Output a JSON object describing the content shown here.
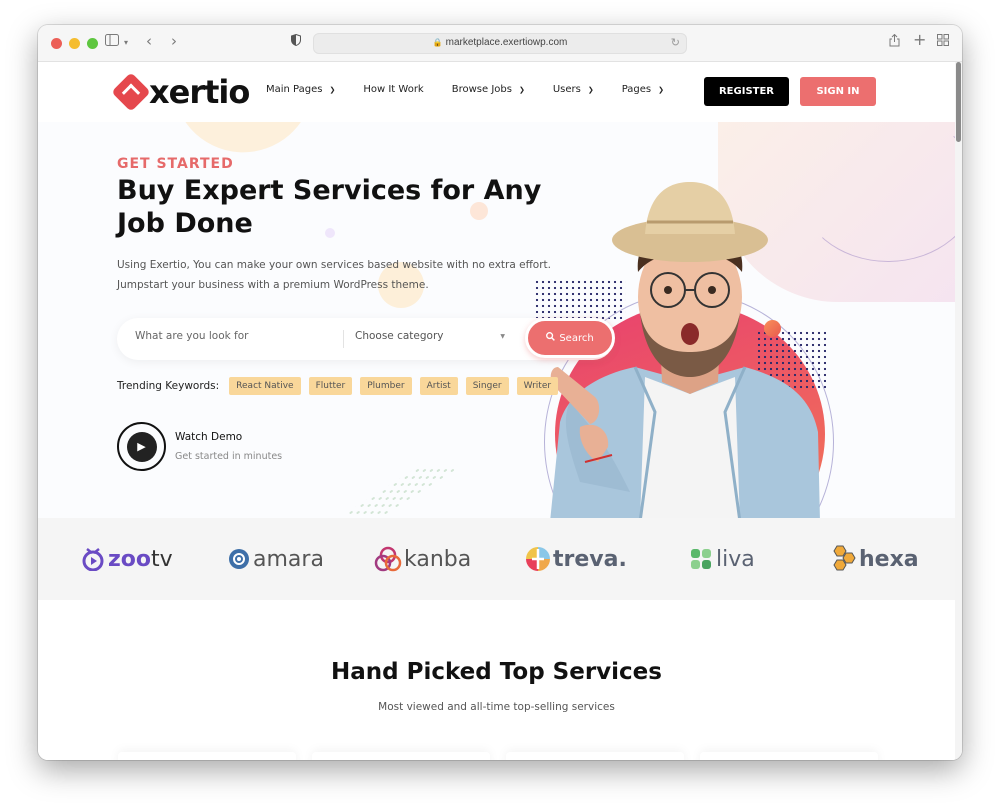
{
  "browser": {
    "url": "marketplace.exertiowp.com",
    "traffic_lights": [
      "#ec5f57",
      "#f5bd2f",
      "#5ec63f"
    ]
  },
  "header": {
    "logo_text": "xertio",
    "nav": [
      {
        "label": "Main Pages",
        "has_dropdown": true
      },
      {
        "label": "How It Work",
        "has_dropdown": false
      },
      {
        "label": "Browse Jobs",
        "has_dropdown": true
      },
      {
        "label": "Users",
        "has_dropdown": true
      },
      {
        "label": "Pages",
        "has_dropdown": true
      }
    ],
    "register_label": "REGISTER",
    "signin_label": "SIGN IN"
  },
  "hero": {
    "eyebrow": "GET STARTED",
    "headline": "Buy Expert Services for Any Job Done",
    "lead_line1": "Using Exertio, You can make your own services based website with no extra effort.",
    "lead_line2": "Jumpstart your business with a premium WordPress theme.",
    "search": {
      "placeholder": "What are you look for",
      "value": "",
      "category_selected": "Choose category",
      "button_label": "Search"
    },
    "trending_label": "Trending Keywords:",
    "trending_tags": [
      "React Native",
      "Flutter",
      "Plumber",
      "Artist",
      "Singer",
      "Writer"
    ],
    "demo_title": "Watch Demo",
    "demo_subtitle": "Get started in minutes"
  },
  "brands": [
    {
      "name": "zootv",
      "part1": "zoo",
      "part2": "tv",
      "color": "#6a4bc4"
    },
    {
      "name": "amara",
      "part1": "amara",
      "color": "#3e6fa8"
    },
    {
      "name": "kanba",
      "part1": "kanba",
      "color": "#c2366f"
    },
    {
      "name": "treva",
      "part1": "treva.",
      "color": "#e9893b"
    },
    {
      "name": "liva",
      "part1": "liva",
      "color": "#4cae5f"
    },
    {
      "name": "hexa",
      "part1": "hexa",
      "color": "#f0a93a"
    }
  ],
  "services": {
    "title": "Hand Picked Top Services",
    "subtitle": "Most viewed and all-time top-selling services"
  },
  "colors": {
    "accent": "#ec6f6f",
    "tag_bg": "#f9d79a",
    "dark": "#000000"
  }
}
